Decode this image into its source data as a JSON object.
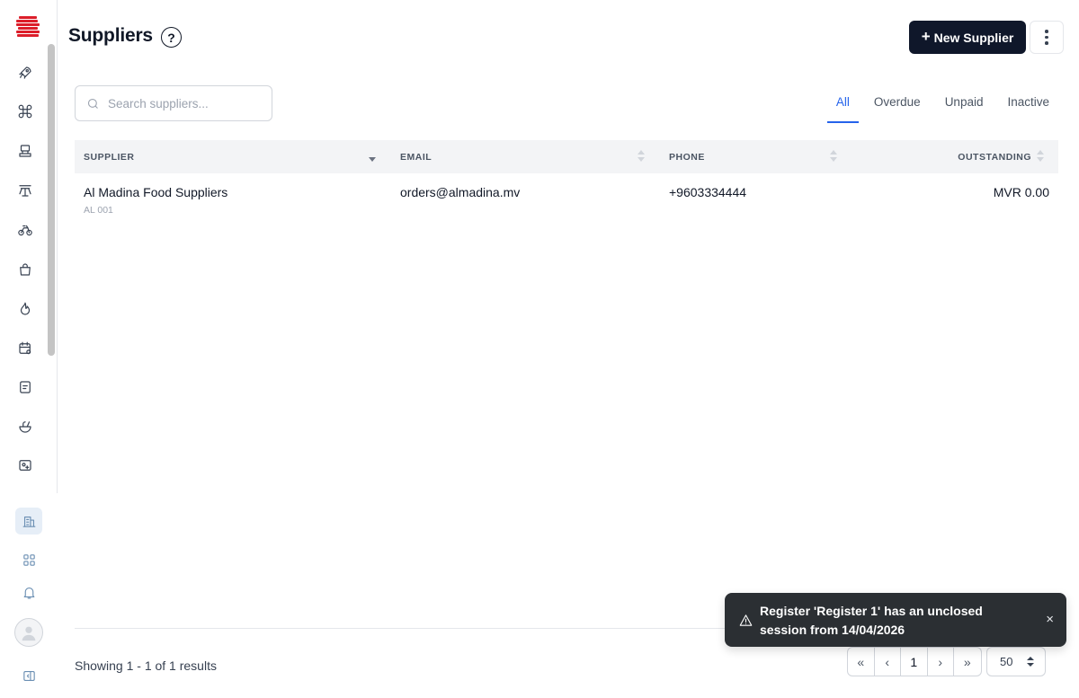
{
  "app": {
    "brand_color": "#dc1e2a",
    "sidebar_nav": [
      {
        "icon": "rocket-icon"
      },
      {
        "icon": "command-icon"
      },
      {
        "icon": "register-icon"
      },
      {
        "icon": "table-icon"
      },
      {
        "icon": "bicycle-icon"
      },
      {
        "icon": "bag-icon"
      },
      {
        "icon": "flame-icon"
      },
      {
        "icon": "calendar-settings-icon"
      },
      {
        "icon": "receipt-icon"
      },
      {
        "icon": "food-bowl-icon"
      },
      {
        "icon": "image-add-icon"
      }
    ],
    "sidebar_bottom": [
      {
        "icon": "building-icon",
        "active": true
      },
      {
        "icon": "grid-icon"
      },
      {
        "icon": "bell-icon"
      },
      {
        "icon": "user-avatar-icon"
      },
      {
        "icon": "collapse-sidebar-icon"
      }
    ]
  },
  "header": {
    "title": "Suppliers",
    "help_label": "?",
    "new_button_label": "New Supplier",
    "new_button_icon": "+"
  },
  "search": {
    "placeholder": "Search suppliers...",
    "value": ""
  },
  "tabs": [
    {
      "label": "All",
      "active": true
    },
    {
      "label": "Overdue"
    },
    {
      "label": "Unpaid"
    },
    {
      "label": "Inactive"
    }
  ],
  "table": {
    "columns": [
      "SUPPLIER",
      "EMAIL",
      "PHONE",
      "OUTSTANDING"
    ],
    "rows": [
      {
        "name": "Al Madina Food Suppliers",
        "code": "AL 001",
        "email": "orders@almadina.mv",
        "phone": "+9603334444",
        "outstanding": "MVR 0.00"
      }
    ]
  },
  "footer": {
    "showing": "Showing 1 - 1 of 1 results",
    "pager": [
      "«",
      "‹",
      "1",
      "›",
      "»"
    ],
    "per_page": "50"
  },
  "toast": {
    "message": "Register 'Register 1' has an unclosed session from 14/04/2026",
    "close_label": "×"
  },
  "accent_color": "#2563eb"
}
